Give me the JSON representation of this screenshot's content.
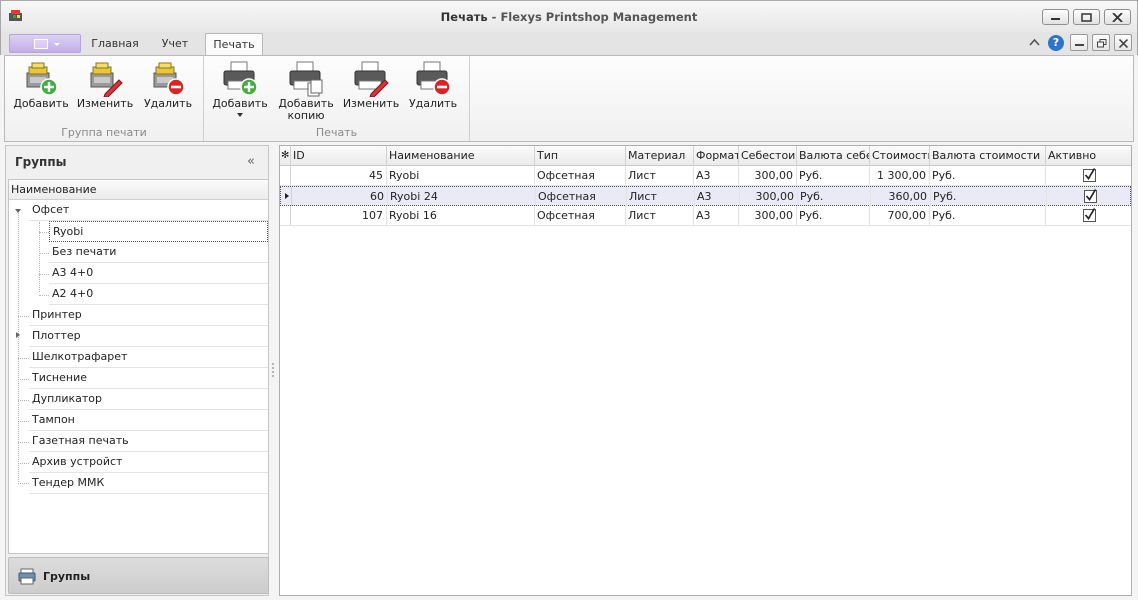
{
  "window": {
    "title": "Печать",
    "subtitle": " - Flexys Printshop Management"
  },
  "ribbon": {
    "tabs": {
      "home": "Главная",
      "account": "Учет",
      "print": "Печать"
    },
    "groups": [
      {
        "caption": "Группа печати",
        "buttons": [
          {
            "label": "Добавить",
            "icon": "add-group-icon"
          },
          {
            "label": "Изменить",
            "icon": "edit-group-icon"
          },
          {
            "label": "Удалить",
            "icon": "delete-group-icon"
          }
        ]
      },
      {
        "caption": "Печать",
        "buttons": [
          {
            "label": "Добавить",
            "icon": "add-printer-icon",
            "dropdown": true
          },
          {
            "label": "Добавить копию",
            "icon": "copy-printer-icon"
          },
          {
            "label": "Изменить",
            "icon": "edit-printer-icon"
          },
          {
            "label": "Удалить",
            "icon": "delete-printer-icon"
          }
        ]
      }
    ]
  },
  "groups_panel": {
    "title": "Группы",
    "collapse_glyph": "«",
    "tree_header": "Наименование",
    "nodes": [
      {
        "label": "Офсет",
        "expanded": true
      },
      {
        "label": "Ryobi",
        "child": true,
        "selected": true
      },
      {
        "label": "Без печати",
        "child": true
      },
      {
        "label": "А3 4+0",
        "child": true
      },
      {
        "label": "А2 4+0",
        "child": true
      },
      {
        "label": "Принтер"
      },
      {
        "label": "Плоттер",
        "collapsed": true
      },
      {
        "label": "Шелкотрафарет"
      },
      {
        "label": "Тиснение"
      },
      {
        "label": "Дупликатор"
      },
      {
        "label": "Тампон"
      },
      {
        "label": "Газетная печать"
      },
      {
        "label": "Архив устройст"
      },
      {
        "label": "Тендер ММК"
      }
    ],
    "nav_button": "Группы"
  },
  "grid": {
    "columns": [
      "ID",
      "Наименование",
      "Тип",
      "Материал",
      "Формат",
      "Себестоим",
      "Валюта себес",
      "Стоимость",
      "Валюта стоимости",
      "Активно"
    ],
    "rows": [
      {
        "id": "45",
        "name": "Ryobi",
        "type": "Офсетная",
        "material": "Лист",
        "format": "А3",
        "cost": "300,00",
        "cost_currency": "Руб.",
        "price": "1 300,00",
        "price_currency": "Руб.",
        "active": true
      },
      {
        "id": "60",
        "name": "Ryobi 24",
        "type": "Офсетная",
        "material": "Лист",
        "format": "А3",
        "cost": "300,00",
        "cost_currency": "Руб.",
        "price": "360,00",
        "price_currency": "Руб.",
        "active": true,
        "selected": true
      },
      {
        "id": "107",
        "name": "Ryobi 16",
        "type": "Офсетная",
        "material": "Лист",
        "format": "А3",
        "cost": "300,00",
        "cost_currency": "Руб.",
        "price": "700,00",
        "price_currency": "Руб.",
        "active": true
      }
    ]
  },
  "colors": {
    "app_menu": "#c9b6ec",
    "help": "#2e74c9",
    "selection": "#e9eaf6"
  }
}
